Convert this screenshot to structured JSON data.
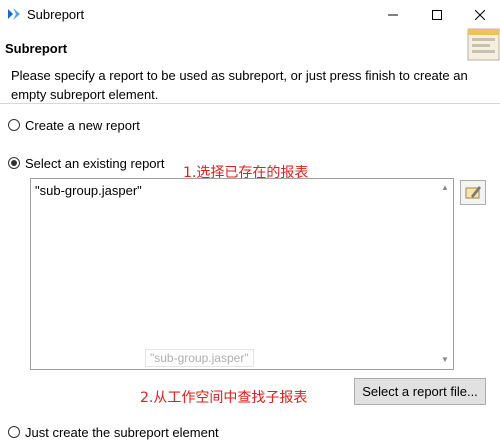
{
  "window": {
    "title": "Subreport",
    "minimize_icon": "minimize-icon",
    "maximize_icon": "maximize-icon",
    "close_icon": "close-icon",
    "app_icon": "jaspersoft-logo-icon"
  },
  "header": {
    "title": "Subreport",
    "description": "Please specify a report to be used as subreport, or just press finish to create an empty subreport element.",
    "wizard_image_icon": "report-wizard-icon"
  },
  "options": {
    "new_report_label": "Create a new report",
    "existing_report_label": "Select an existing report",
    "empty_element_label": "Just create the subreport element",
    "selected": "existing_report"
  },
  "report_list": {
    "items": [
      "\"sub-group.jasper\""
    ],
    "drag_ghost": "\"sub-group.jasper\""
  },
  "buttons": {
    "browse_icon": "edit-expression-icon",
    "select_file_label": "Select a report file..."
  },
  "annotations": {
    "step1": "1.选择已存在的报表",
    "step2": "2.从工作空间中查找子报表"
  },
  "colors": {
    "annotation": "#e0201c",
    "accent": "#1b6ac9"
  }
}
